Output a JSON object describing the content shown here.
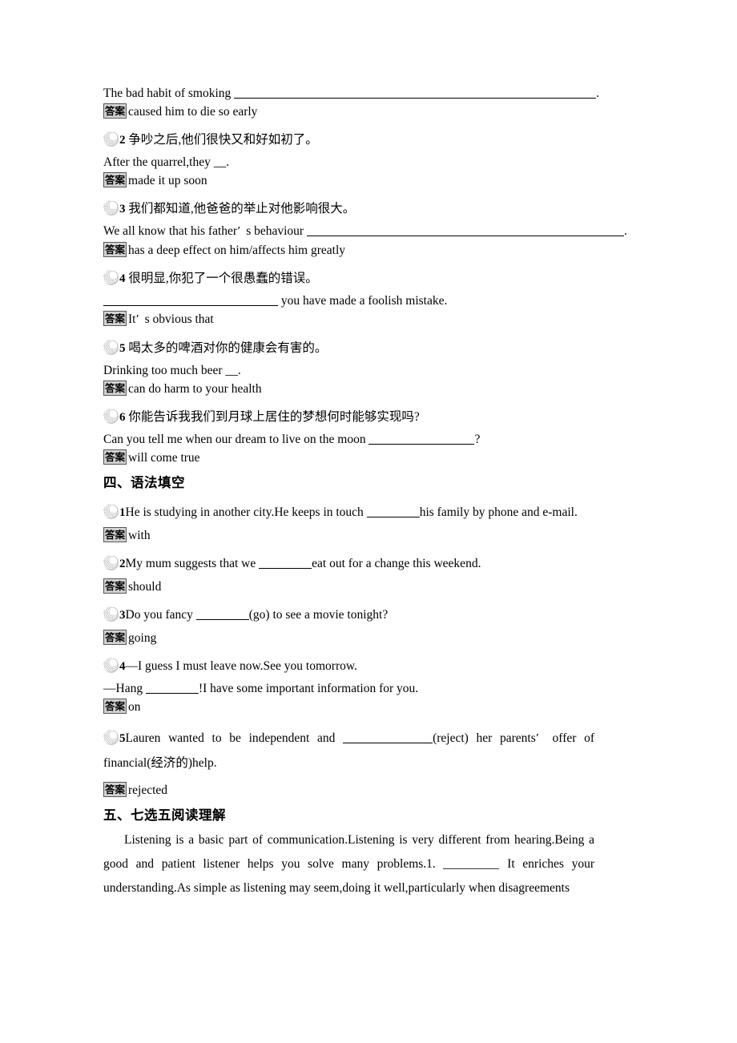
{
  "badge_label": "答案",
  "section_iii_items": [
    {
      "prompt_prefix": "The bad habit of smoking ",
      "prompt_suffix": ".",
      "answer": "caused him to die so early"
    },
    {
      "number": "2",
      "chinese": "争吵之后,他们很快又和好如初了。",
      "prompt": "After the quarrel,they __.",
      "answer": "made it up soon"
    },
    {
      "number": "3",
      "chinese": "我们都知道,他爸爸的举止对他影响很大。",
      "prompt_prefix": "We all know that his father",
      "prompt_mid": "s behaviour ",
      "prompt_suffix": ".",
      "answer": "has a deep effect on him/affects him greatly"
    },
    {
      "number": "4",
      "chinese": "很明显,你犯了一个很愚蠢的错误。",
      "prompt_suffix": " you have made a foolish mistake.",
      "answer_prefix": "It",
      "answer_suffix": "s obvious that"
    },
    {
      "number": "5",
      "chinese": "喝太多的啤酒对你的健康会有害的。",
      "prompt": "Drinking too much beer __.",
      "answer": "can do harm to your health"
    },
    {
      "number": "6",
      "chinese": "你能告诉我我们到月球上居住的梦想何时能够实现吗?",
      "prompt_prefix": "Can you tell me when our dream to live on the moon ",
      "prompt_suffix": "?",
      "answer": "will come true"
    }
  ],
  "section_iv": {
    "heading": "四、语法填空",
    "items": [
      {
        "number": "1",
        "text_before": "He is studying in another city.He keeps in touch ",
        "text_after": "his family by phone and e-mail.",
        "answer": "with"
      },
      {
        "number": "2",
        "text_before": "My mum suggests that we ",
        "text_after": "eat out for a change this weekend.",
        "answer": "should"
      },
      {
        "number": "3",
        "text_before": "Do you fancy ",
        "text_after": "(go) to see a movie tonight?",
        "answer": "going"
      },
      {
        "number": "4",
        "text_line1": "—I guess I must leave now.See you tomorrow.",
        "text_line2_before": "—Hang ",
        "text_line2_after": "!I have some important information for you.",
        "answer": "on"
      },
      {
        "number": "5",
        "text_before": "Lauren wanted to be independent and ",
        "text_mid": "(reject) her parents",
        "text_after": " offer of financial(经济的)help.",
        "answer": "rejected"
      }
    ]
  },
  "section_v": {
    "heading": "五、七选五阅读理解",
    "paragraph_part1": "Listening is a basic part of communication.Listening is very different from hearing.Being a good and patient listener helps you solve many problems.1.",
    "paragraph_part2": "It enriches your understanding.As simple as listening may seem,doing it well,particularly when disagreements"
  }
}
